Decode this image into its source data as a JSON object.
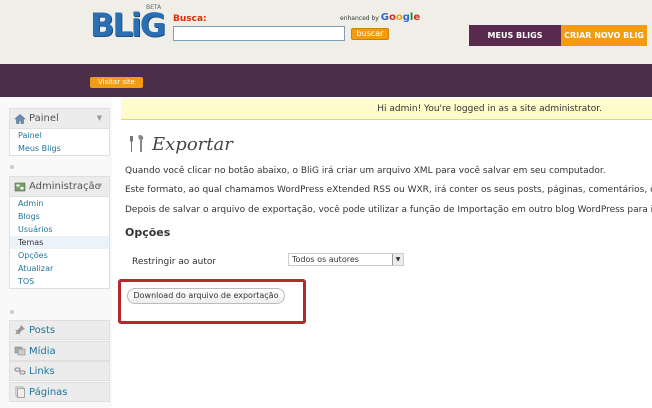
{
  "header": {
    "logo_text": "BLiG",
    "logo_beta": "BETA",
    "search_label": "Busca:",
    "search_value": "",
    "enhanced_text": "enhanced by",
    "google": [
      "G",
      "o",
      "o",
      "g",
      "l",
      "e"
    ],
    "search_button": "buscar",
    "meus_bligs": "MEUS BLIGS",
    "criar_blig": "CRIAR NOVO BLIG",
    "visitar": "Visitar site"
  },
  "sidebar": {
    "painel": {
      "title": "Painel",
      "items": [
        "Painel",
        "Meus Bligs"
      ]
    },
    "administracao": {
      "title": "Administração",
      "items": [
        "Admin",
        "Blogs",
        "Usuários",
        "Temas",
        "Opções",
        "Atualizar",
        "TOS"
      ],
      "active_index": 3
    },
    "rows": [
      "Posts",
      "Mídia",
      "Links",
      "Páginas"
    ]
  },
  "main": {
    "notice": "Hi admin! You're logged in as a site administrator.",
    "title": "Exportar",
    "paragraphs": [
      "Quando você clicar no botão abaixo, o BliG irá criar um arquivo XML para você salvar em seu computador.",
      "Este formato, ao qual chamamos WordPress eXtended RSS ou WXR, irá conter os seus posts, páginas, comentários, ca",
      "Depois de salvar o arquivo de exportação, você pode utilizar a função de Importação em outro blog WordPress para in"
    ],
    "options_title": "Opções",
    "restrict_label": "Restringir ao autor",
    "author_select": "Todos os autores",
    "download_button": "Download do arquivo de exportação"
  },
  "colors": {
    "purple": "#4b2e4a",
    "orange": "#f39c12",
    "highlight": "#b5282c",
    "link": "#21759b"
  }
}
